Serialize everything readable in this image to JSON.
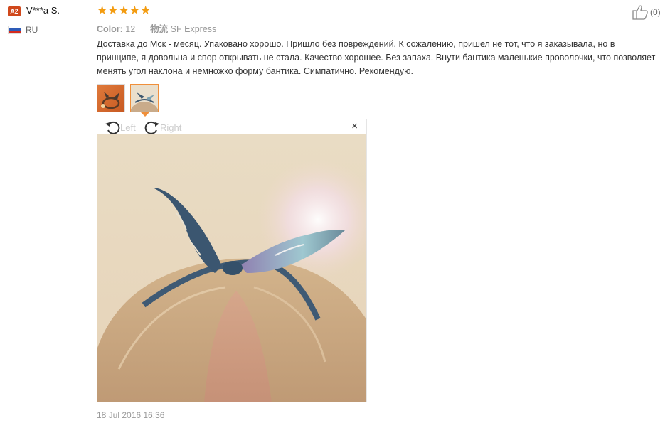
{
  "reviewer": {
    "level_badge": "A2",
    "name": "V***a S.",
    "country": "RU"
  },
  "rating": {
    "stars": 5,
    "max": 5,
    "star_glyphs": "★★★★★",
    "color": "#f39c11"
  },
  "likes": {
    "count_label": "(0)",
    "icon": "thumbs-up-icon"
  },
  "meta": {
    "color_label": "Color:",
    "color_value": "12",
    "shipping_label": "物流",
    "shipping_value": "SF Express"
  },
  "review_text": "Доставка до Мск - месяц. Упаковано хорошо. Пришло без повреждений. К сожалению, пришел не тот, что я заказывала, но в принципе, я довольна и спор открывать не стала. Качество хорошее. Без запаха. Внути бантика маленькие проволочки, что позволяет менять угол наклона и немножко форму бантика. Симпатично. Рекомендую.",
  "viewer": {
    "rotate_left_label": "Left",
    "rotate_right_label": "Right",
    "close_glyph": "×"
  },
  "timestamp": "18 Jul 2016 16:36",
  "colors": {
    "badge": "#d0481c",
    "accent": "#f08f3a"
  }
}
